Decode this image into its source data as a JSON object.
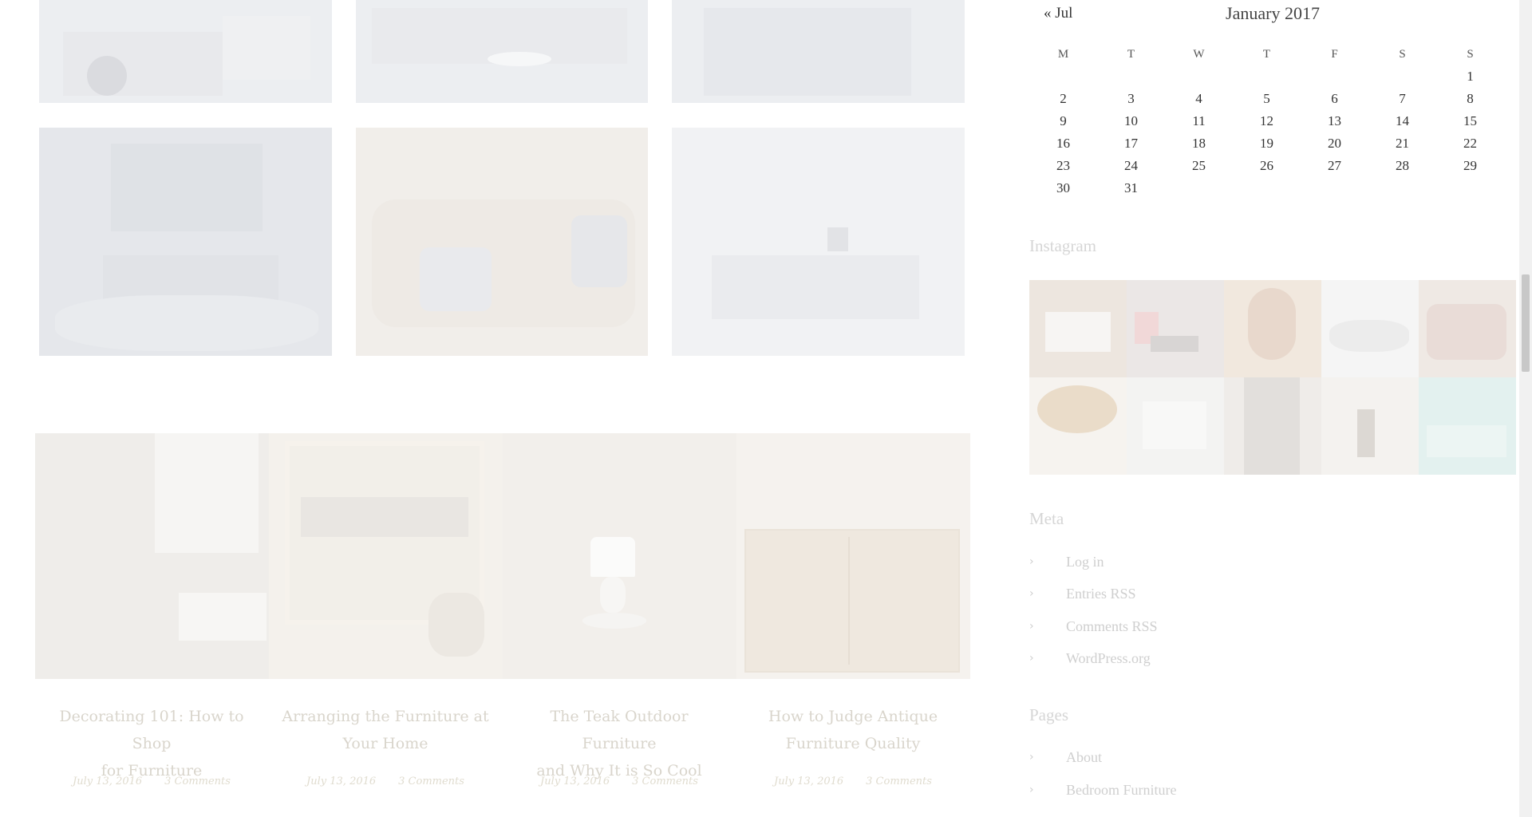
{
  "calendar": {
    "prev_label": "« Jul",
    "title": "January 2017",
    "weekdays": [
      "M",
      "T",
      "W",
      "T",
      "F",
      "S",
      "S"
    ],
    "weeks": [
      [
        "",
        "",
        "",
        "",
        "",
        "",
        "1"
      ],
      [
        "2",
        "3",
        "4",
        "5",
        "6",
        "7",
        "8"
      ],
      [
        "9",
        "10",
        "11",
        "12",
        "13",
        "14",
        "15"
      ],
      [
        "16",
        "17",
        "18",
        "19",
        "20",
        "21",
        "22"
      ],
      [
        "23",
        "24",
        "25",
        "26",
        "27",
        "28",
        "29"
      ],
      [
        "30",
        "31",
        "",
        "",
        "",
        "",
        ""
      ]
    ]
  },
  "instagram": {
    "title": "Instagram"
  },
  "meta": {
    "title": "Meta",
    "items": [
      "Log in",
      "Entries RSS",
      "Comments RSS",
      "WordPress.org"
    ]
  },
  "pages": {
    "title": "Pages",
    "items": [
      "About",
      "Bedroom Furniture"
    ]
  },
  "posts": [
    {
      "title_line1": "Decorating 101: How to Shop",
      "title_line2": "for Furniture",
      "date": "July 13, 2016",
      "comments": "3 Comments"
    },
    {
      "title_line1": "Arranging the Furniture at",
      "title_line2": "Your Home",
      "date": "July 13, 2016",
      "comments": "3 Comments"
    },
    {
      "title_line1": "The Teak Outdoor Furniture",
      "title_line2": "and Why It is So Cool",
      "date": "July 13, 2016",
      "comments": "3 Comments"
    },
    {
      "title_line1": "How to Judge Antique",
      "title_line2": "Furniture Quality",
      "date": "July 13, 2016",
      "comments": "3 Comments"
    }
  ],
  "colors": {
    "text_dark": "#333333",
    "text_faded": "#cfcfcf",
    "post_title": "#d9d5cc",
    "tile_bg": "#eceef1"
  }
}
